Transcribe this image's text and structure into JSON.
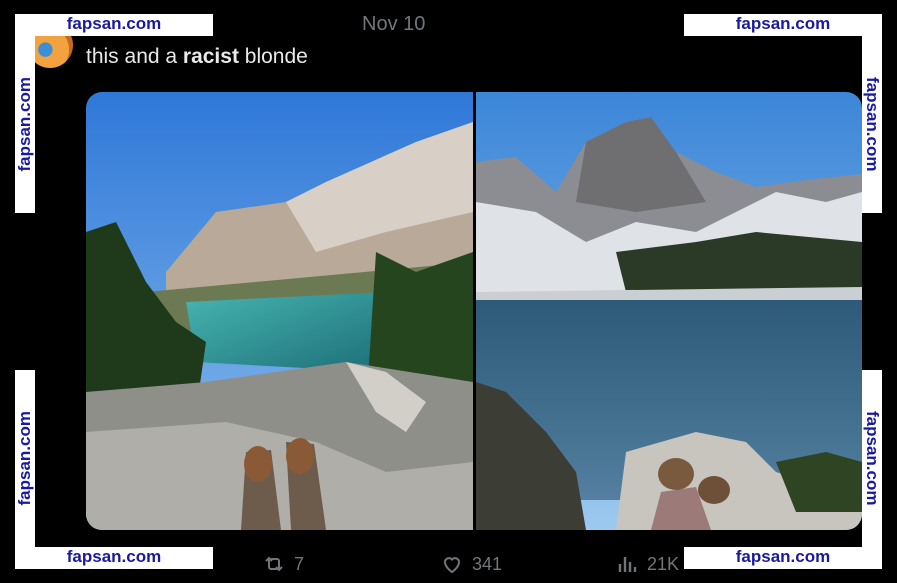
{
  "post": {
    "date": "Nov 10",
    "text_prefix": "this and a ",
    "text_bold": "racist",
    "text_suffix": " blonde"
  },
  "media": {
    "left_photo": "alpine-lake-turquoise",
    "right_photo": "alpine-lake-blue"
  },
  "actions": {
    "reposts": "7",
    "likes": "341",
    "views": "21K"
  },
  "watermark": {
    "text": "fapsan.com",
    "color": "#1a1aa0"
  },
  "icons": {
    "repost": "repost-icon",
    "like": "heart-icon",
    "views": "bar-chart-icon"
  }
}
